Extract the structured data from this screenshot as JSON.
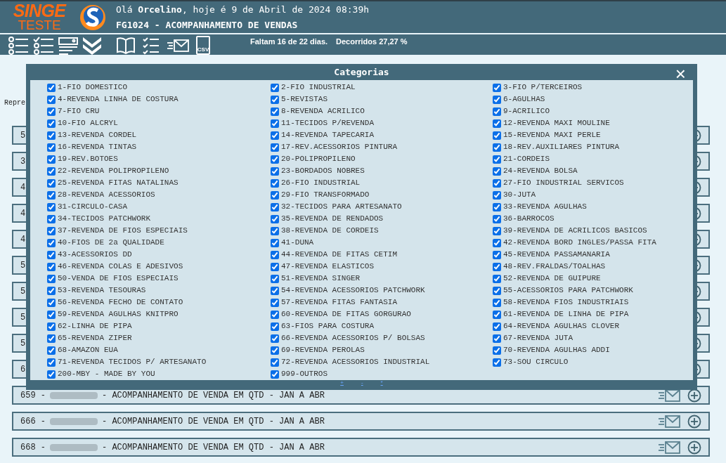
{
  "logo": {
    "line1": "SINGE",
    "line2": "TESTE"
  },
  "header": {
    "greeting": "Olá **Orcelino**, hoje é 9 de Abril de 2024 08:39h",
    "title": "FG1024 - ACOMPANHAMENTO DE VENDAS"
  },
  "toolbar": {
    "csv_label": "CSV",
    "days_left": "Faltam 16 de 22 dias.",
    "elapsed": "Decorridos 27,27 %"
  },
  "page_label": "Repre",
  "rows": [
    {
      "code": "5"
    },
    {
      "code": "3"
    },
    {
      "code": "4"
    },
    {
      "code": "4"
    },
    {
      "code": "4"
    },
    {
      "code": "5"
    },
    {
      "code": "5"
    },
    {
      "code": "5"
    },
    {
      "code": "5"
    },
    {
      "code": "6"
    },
    {
      "code": "659 -",
      "title": "- ACOMPANHAMENTO DE VENDA EM QTD - JAN A ABR"
    },
    {
      "code": "666 -",
      "title": "- ACOMPANHAMENTO DE VENDA EM QTD - JAN A ABR"
    },
    {
      "code": "668 -",
      "title": "- ACOMPANHAMENTO DE VENDA EM QTD - JAN A ABR"
    }
  ],
  "dialog": {
    "title": "Categorias",
    "close": "×",
    "footer_links": [
      "+",
      "-",
      "*"
    ],
    "categories": [
      {
        "label": "1-FIO DOMESTICO",
        "checked": true
      },
      {
        "label": "2-FIO INDUSTRIAL",
        "checked": true
      },
      {
        "label": "3-FIO P/TERCEIROS",
        "checked": true
      },
      {
        "label": "4-REVENDA LINHA DE COSTURA",
        "checked": true
      },
      {
        "label": "5-REVISTAS",
        "checked": true
      },
      {
        "label": "6-AGULHAS",
        "checked": true
      },
      {
        "label": "7-FIO CRU",
        "checked": true
      },
      {
        "label": "8-REVENDA ACRILICO",
        "checked": true
      },
      {
        "label": "9-ACRILICO",
        "checked": true
      },
      {
        "label": "10-FIO ALCRYL",
        "checked": true
      },
      {
        "label": "11-TECIDOS P/REVENDA",
        "checked": true
      },
      {
        "label": "12-REVENDA MAXI MOULINE",
        "checked": true
      },
      {
        "label": "13-REVENDA CORDEL",
        "checked": true
      },
      {
        "label": "14-REVENDA TAPECARIA",
        "checked": true
      },
      {
        "label": "15-REVENDA MAXI PERLE",
        "checked": true
      },
      {
        "label": "16-REVENDA TINTAS",
        "checked": true
      },
      {
        "label": "17-REV.ACESSORIOS PINTURA",
        "checked": true
      },
      {
        "label": "18-REV.AUXILIARES PINTURA",
        "checked": true
      },
      {
        "label": "19-REV.BOTOES",
        "checked": true
      },
      {
        "label": "20-POLIPROPILENO",
        "checked": true
      },
      {
        "label": "21-CORDEIS",
        "checked": true
      },
      {
        "label": "22-REVENDA POLIPROPILENO",
        "checked": true
      },
      {
        "label": "23-BORDADOS NOBRES",
        "checked": true
      },
      {
        "label": "24-REVENDA BOLSA",
        "checked": true
      },
      {
        "label": "25-REVENDA FITAS NATALINAS",
        "checked": true
      },
      {
        "label": "26-FIO INDUSTRIAL",
        "checked": true
      },
      {
        "label": "27-FIO INDUSTRIAL SERVICOS",
        "checked": true
      },
      {
        "label": "28-REVENDA ACESSORIOS",
        "checked": true
      },
      {
        "label": "29-FIO TRANSFORMADO",
        "checked": true
      },
      {
        "label": "30-JUTA",
        "checked": true
      },
      {
        "label": "31-CIRCULO-CASA",
        "checked": true
      },
      {
        "label": "32-TECIDOS PARA ARTESANATO",
        "checked": true
      },
      {
        "label": "33-REVENDA AGULHAS",
        "checked": true
      },
      {
        "label": "34-TECIDOS PATCHWORK",
        "checked": true
      },
      {
        "label": "35-REVENDA DE RENDADOS",
        "checked": true
      },
      {
        "label": "36-BARROCOS",
        "checked": true
      },
      {
        "label": "37-REVENDA DE FIOS ESPECIAIS",
        "checked": true
      },
      {
        "label": "38-REVENDA DE CORDEIS",
        "checked": true
      },
      {
        "label": "39-REVENDA DE ACRILICOS BASICOS",
        "checked": true
      },
      {
        "label": "40-FIOS DE 2a QUALIDADE",
        "checked": true
      },
      {
        "label": "41-DUNA",
        "checked": true
      },
      {
        "label": "42-REVENDA BORD INGLES/PASSA FITA",
        "checked": true
      },
      {
        "label": "43-ACESSORIOS DD",
        "checked": true
      },
      {
        "label": "44-REVENDA DE FITAS CETIM",
        "checked": true
      },
      {
        "label": "45-REVENDA PASSAMANARIA",
        "checked": true
      },
      {
        "label": "46-REVENDA COLAS E ADESIVOS",
        "checked": true
      },
      {
        "label": "47-REVENDA ELASTICOS",
        "checked": true
      },
      {
        "label": "48-REV.FRALDAS/TOALHAS",
        "checked": true
      },
      {
        "label": "50-VENDA DE FIOS ESPECIAIS",
        "checked": true
      },
      {
        "label": "51-REVENDA SINGER",
        "checked": true
      },
      {
        "label": "52-REVENDA DE GUIPURE",
        "checked": true
      },
      {
        "label": "53-REVENDA TESOURAS",
        "checked": true
      },
      {
        "label": "54-REVENDA ACESSORIOS PATCHWORK",
        "checked": true
      },
      {
        "label": "55-ACESSORIOS PARA PATCHWORK",
        "checked": true
      },
      {
        "label": "56-REVENDA FECHO DE CONTATO",
        "checked": true
      },
      {
        "label": "57-REVENDA FITAS FANTASIA",
        "checked": true
      },
      {
        "label": "58-REVENDA FIOS INDUSTRIAIS",
        "checked": true
      },
      {
        "label": "59-REVENDA AGULHAS KNITPRO",
        "checked": true
      },
      {
        "label": "60-REVENDA DE FITAS GORGURAO",
        "checked": true
      },
      {
        "label": "61-REVENDA DE LINHA DE PIPA",
        "checked": true
      },
      {
        "label": "62-LINHA DE PIPA",
        "checked": true
      },
      {
        "label": "63-FIOS PARA COSTURA",
        "checked": true
      },
      {
        "label": "64-REVENDA AGULHAS CLOVER",
        "checked": true
      },
      {
        "label": "65-REVENDA ZIPER",
        "checked": true
      },
      {
        "label": "66-REVENDA ACESSORIOS P/ BOLSAS",
        "checked": true
      },
      {
        "label": "67-REVENDA JUTA",
        "checked": true
      },
      {
        "label": "68-AMAZON EUA",
        "checked": true
      },
      {
        "label": "69-REVENDA PEROLAS",
        "checked": true
      },
      {
        "label": "70-REVENDA AGULHAS ADDI",
        "checked": true
      },
      {
        "label": "71-REVENDA TECIDOS P/ ARTESANATO",
        "checked": true
      },
      {
        "label": "72-REVENDA ACESSORIOS INDUSTRIAL",
        "checked": true
      },
      {
        "label": "73-SOU CIRCULO",
        "checked": true
      },
      {
        "label": "200-MBY - MADE BY YOU",
        "checked": true
      },
      {
        "label": "999-OUTROS",
        "checked": true
      }
    ]
  }
}
